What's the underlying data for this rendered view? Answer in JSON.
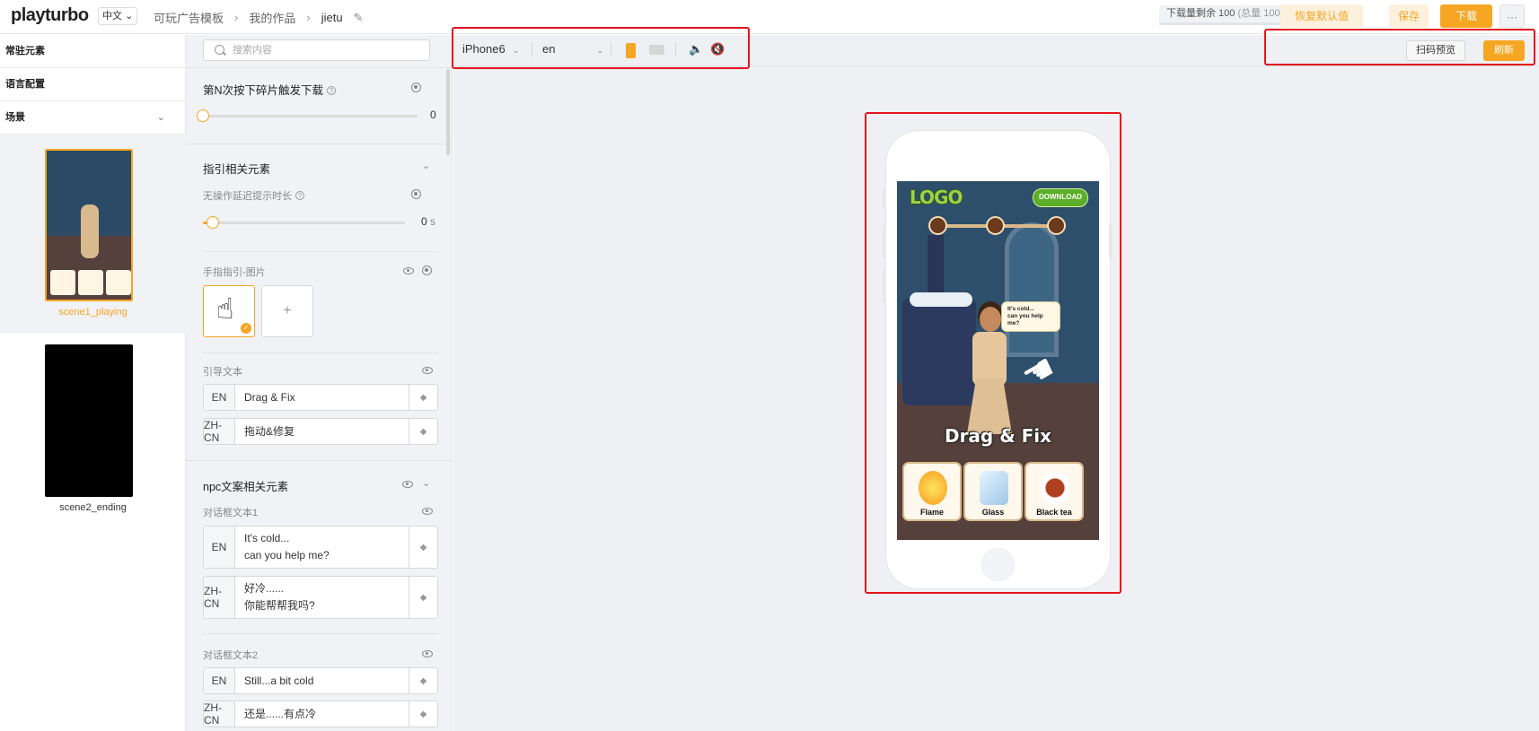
{
  "header": {
    "logo": "playturbo",
    "language": "中文",
    "breadcrumb": [
      "可玩广告模板",
      "我的作品",
      "jietu"
    ],
    "quota_label": "下载量剩余 100",
    "quota_total": "(总量 100)",
    "restore_label": "恢复默认值",
    "save_label": "保存",
    "download_label": "下载",
    "more_label": "···"
  },
  "sidebar": {
    "items": [
      {
        "label": "常驻元素"
      },
      {
        "label": "语言配置"
      },
      {
        "label": "场景"
      }
    ],
    "scenes": [
      {
        "label": "scene1_playing",
        "active": true
      },
      {
        "label": "scene2_ending",
        "active": false
      }
    ]
  },
  "panel": {
    "search_placeholder": "搜索内容",
    "fragment_title": "第N次按下碎片触发下载",
    "fragment_value": "0",
    "fragment_level": 0,
    "guide_title": "指引相关元素",
    "delay_label": "无操作延迟提示时长",
    "delay_value": "0",
    "delay_unit": "s",
    "delay_level": 0.05,
    "finger_label": "手指指引-图片",
    "add_label": "+",
    "guide_text_label": "引导文本",
    "guide_texts": [
      {
        "lang": "EN",
        "text": "Drag & Fix"
      },
      {
        "lang": "ZH-CN",
        "text": "拖动&修复"
      }
    ],
    "npc_title": "npc文案相关元素",
    "dialog1_label": "对话框文本1",
    "dialog1": [
      {
        "lang": "EN",
        "text": "It's cold...\ncan you help me?"
      },
      {
        "lang": "ZH-CN",
        "text": "好冷......\n你能帮帮我吗?"
      }
    ],
    "dialog2_label": "对话框文本2",
    "dialog2": [
      {
        "lang": "EN",
        "text": "Still...a bit cold"
      },
      {
        "lang": "ZH-CN",
        "text": "还是......有点冷"
      }
    ]
  },
  "canvas_toolbar": {
    "device": "iPhone6",
    "language": "en",
    "scan_label": "扫码预览",
    "refresh_label": "刷新"
  },
  "game": {
    "logo": "LOGO",
    "download": "DOWNLOAD",
    "bubble": "It's cold...\ncan you help me?",
    "guide_text": "Drag & Fix",
    "cards": [
      "Flame",
      "Glass",
      "Black tea"
    ]
  },
  "colors": {
    "accent": "#f5a623",
    "highlight": "#e3141e"
  }
}
